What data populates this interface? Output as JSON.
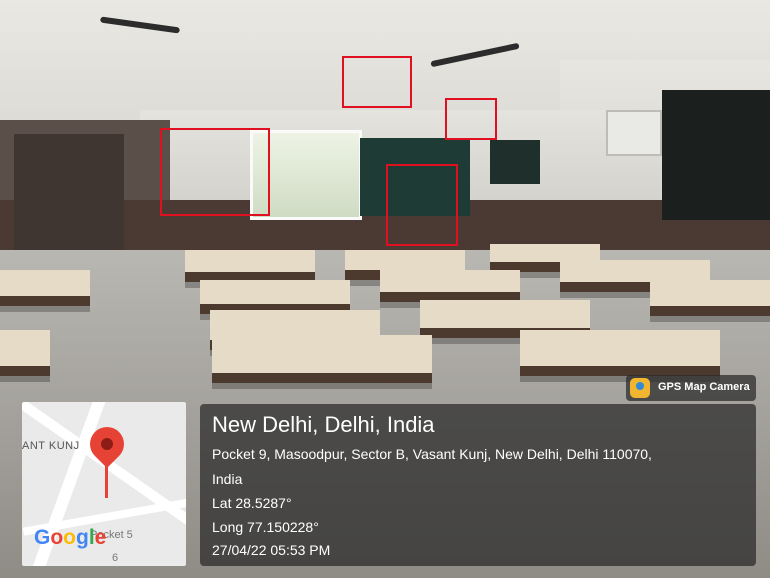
{
  "overlay": {
    "place_title": "New Delhi, Delhi, India",
    "address_line1": "Pocket 9, Masoodpur, Sector B, Vasant Kunj, New Delhi, Delhi 110070,",
    "address_line2": "India",
    "latitude": "Lat 28.5287°",
    "longitude": "Long 77.150228°",
    "datetime": "27/04/22 05:53 PM"
  },
  "app_badge": {
    "label": "GPS Map Camera",
    "icon": "gps-map-camera-icon"
  },
  "map": {
    "place_label": "ANT KUNJ",
    "sub_label": "Pocket 5",
    "sub_label2": "6",
    "brand": [
      "G",
      "o",
      "o",
      "g",
      "l",
      "e"
    ],
    "brand_colors": [
      "#4285F4",
      "#EA4335",
      "#FBBC05",
      "#4285F4",
      "#34A853",
      "#EA4335"
    ],
    "pin_icon": "map-pin-icon",
    "pin_color": "#E64235"
  },
  "highlight_color": "#E01020"
}
